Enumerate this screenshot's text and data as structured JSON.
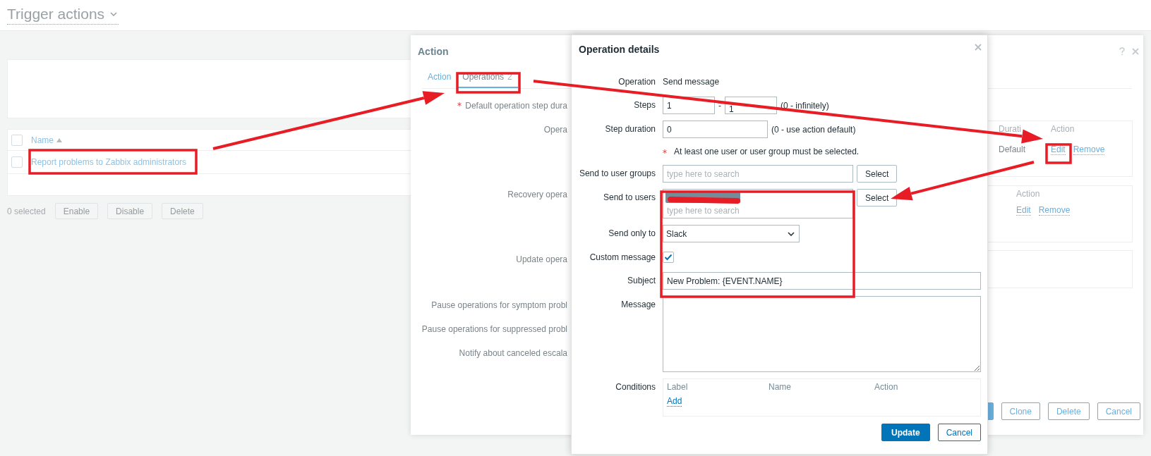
{
  "page": {
    "title": "Trigger actions"
  },
  "actions_table": {
    "header_checked": false,
    "columns": [
      {
        "label": "Name",
        "sorted": true
      }
    ],
    "rows": [
      {
        "name": "Report problems to Zabbix administrators",
        "checked": false
      }
    ]
  },
  "footer": {
    "selected": "0 selected",
    "buttons": [
      {
        "label": "Enable",
        "disabled": true
      },
      {
        "label": "Disable",
        "disabled": true
      },
      {
        "label": "Delete",
        "disabled": true
      }
    ]
  },
  "action_dialog": {
    "title": "Action",
    "tabs": [
      {
        "label": "Action",
        "selected": false
      },
      {
        "label": "Operations",
        "count": "2",
        "selected": true
      }
    ],
    "labels": [
      {
        "text": "Default operation step dura",
        "required": true
      },
      {
        "text": "Opera",
        "required": false
      },
      {
        "text": "Recovery opera",
        "required": false
      },
      {
        "text": "Update opera",
        "required": false
      },
      {
        "text": "Pause operations for symptom probl",
        "required": false
      },
      {
        "text": "Pause operations for suppressed probl",
        "required": false
      },
      {
        "text": "Notify about canceled escala",
        "required": false
      }
    ],
    "operations": {
      "columns": [
        "Durati",
        "Action"
      ],
      "rows": [
        {
          "duration": "Default",
          "links": [
            "Edit",
            "Remove"
          ]
        }
      ]
    },
    "recovery_operations": {
      "columns": [
        "Action"
      ],
      "rows": [
        {
          "links": [
            "Edit",
            "Remove"
          ]
        }
      ]
    },
    "buttons": [
      "Clone",
      "Delete",
      "Cancel"
    ]
  },
  "operation_dialog": {
    "title": "Operation details",
    "fields": [
      {
        "kind": "text",
        "label": "Operation",
        "value": "Send message"
      },
      {
        "kind": "range",
        "label": "Steps",
        "from": "1",
        "separator": "-",
        "to": "1",
        "hint": "(0 - infinitely)"
      },
      {
        "kind": "input",
        "label": "Step duration",
        "value": "0",
        "hint": "(0 - use action default)"
      },
      {
        "kind": "note",
        "text": "At least one user or user group must be selected.",
        "required": true
      },
      {
        "kind": "multiselect",
        "label": "Send to user groups",
        "placeholder": "type here to search",
        "button": "Select",
        "redacted_chip": false
      },
      {
        "kind": "multiselect",
        "label": "Send to users",
        "placeholder": "type here to search",
        "button": "Select",
        "redacted_chip": true
      },
      {
        "kind": "select",
        "label": "Send only to",
        "value": "Slack"
      },
      {
        "kind": "checkbox",
        "label": "Custom message",
        "checked": true
      },
      {
        "kind": "input",
        "label": "Subject",
        "value": "New Problem: {EVENT.NAME}",
        "wide": true
      },
      {
        "kind": "textarea",
        "label": "Message"
      },
      {
        "kind": "conditions",
        "label": "Conditions",
        "columns": [
          "Label",
          "Name",
          "Action"
        ],
        "link": "Add"
      }
    ],
    "buttons": [
      {
        "label": "Update",
        "primary": true
      },
      {
        "label": "Cancel",
        "primary": false
      }
    ]
  }
}
